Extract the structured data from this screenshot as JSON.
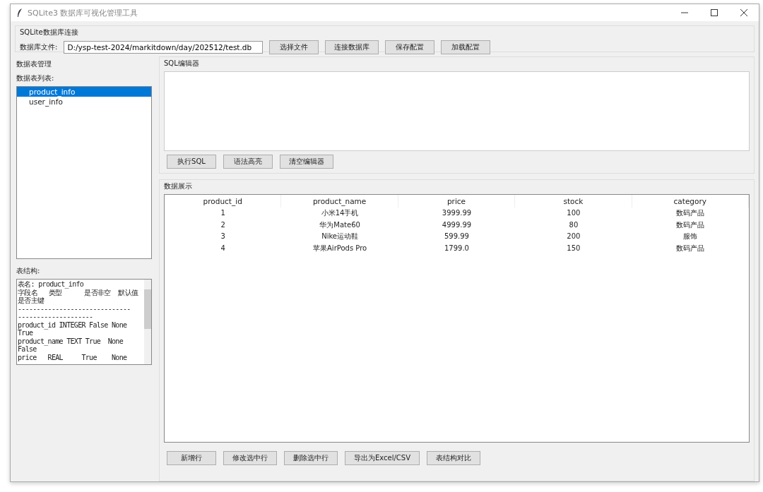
{
  "window": {
    "title": "SQLite3 数据库可视化管理工具"
  },
  "connection": {
    "title": "SQLite数据库连接",
    "file_label": "数据库文件:",
    "file_value": "D:/ysp-test-2024/markitdown/day/202512/test.db",
    "buttons": [
      "选择文件",
      "连接数据库",
      "保存配置",
      "加载配置"
    ]
  },
  "table_manager": {
    "title": "数据表管理",
    "list_label": "数据表列表:",
    "tables": [
      {
        "name": "product_info",
        "selected": true
      },
      {
        "name": "user_info",
        "selected": false
      }
    ],
    "structure_label": "表结构:",
    "structure_lines": [
      "表名: product_info",
      "字段名   类型      是否非空  默认值",
      "是否主键",
      "------------------------------",
      "--------------------",
      "product_id INTEGER False None",
      "True",
      "product_name TEXT True  None",
      "False",
      "price   REAL     True    None"
    ]
  },
  "sql_editor": {
    "title": "SQL编辑器",
    "buttons": [
      "执行SQL",
      "语法高亮",
      "清空编辑器"
    ]
  },
  "data_view": {
    "title": "数据展示",
    "columns": [
      "product_id",
      "product_name",
      "price",
      "stock",
      "category"
    ],
    "rows": [
      [
        "1",
        "小米14手机",
        "3999.99",
        "100",
        "数码产品"
      ],
      [
        "2",
        "华为Mate60",
        "4999.99",
        "80",
        "数码产品"
      ],
      [
        "3",
        "Nike运动鞋",
        "599.99",
        "200",
        "服饰"
      ],
      [
        "4",
        "苹果AirPods Pro",
        "1799.0",
        "150",
        "数码产品"
      ]
    ],
    "buttons": [
      "新增行",
      "修改选中行",
      "删除选中行",
      "导出为Excel/CSV",
      "表结构对比"
    ]
  }
}
